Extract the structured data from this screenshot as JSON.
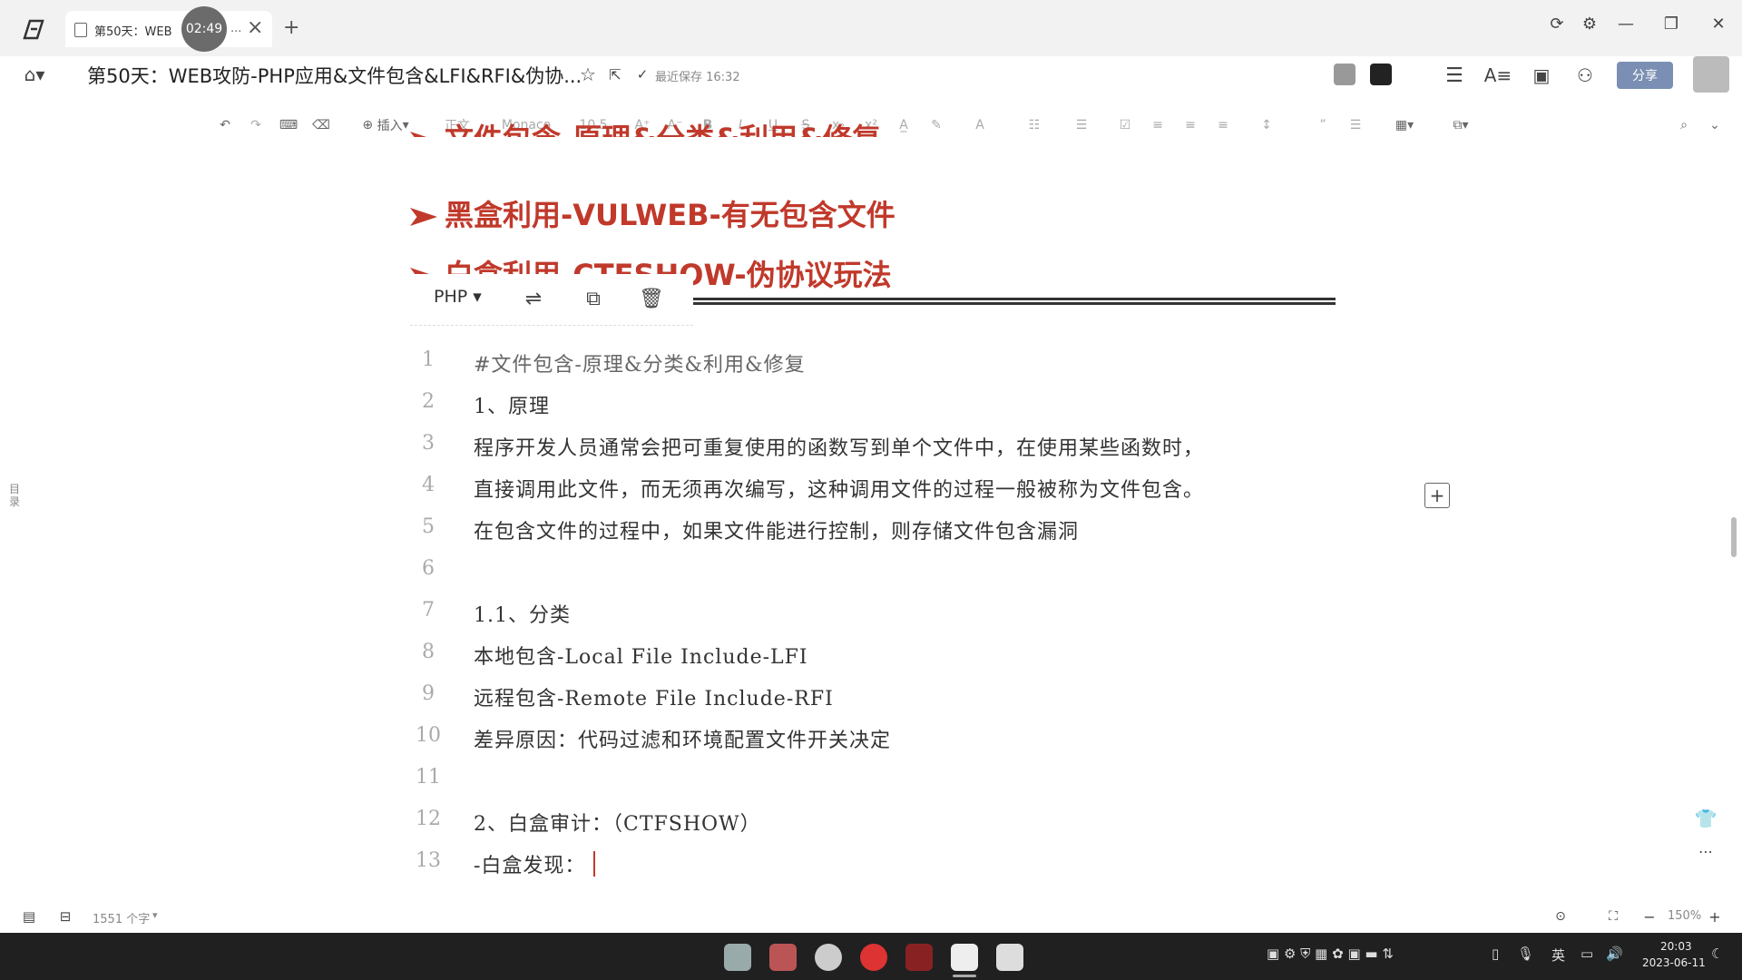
{
  "tab": {
    "title": "第50天：WEB",
    "timer": "02:49",
    "more": "...",
    "close": "×",
    "new": "+"
  },
  "header": {
    "title": "第50天：WEB攻防-PHP应用&文件包含&LFI&RFI&伪协...",
    "saved": "最近保存 16:32",
    "share": "分享"
  },
  "toolbar": {
    "insert": "插入",
    "style": "正文",
    "font": "Monaco",
    "size": "10.5"
  },
  "headings": [
    "文件包含-原理&分类&利用&修复",
    "黑盒利用-VULWEB-有无包含文件",
    "白盒利用-CTFSHOW-伪协议玩法"
  ],
  "code_toolbar": {
    "language": "PHP"
  },
  "code_lines": [
    {
      "n": "1",
      "text": "#文件包含-原理&分类&利用&修复",
      "comment": true
    },
    {
      "n": "2",
      "text": "1、原理",
      "comment": false
    },
    {
      "n": "3",
      "text": "程序开发人员通常会把可重复使用的函数写到单个文件中，在使用某些函数时，",
      "comment": false
    },
    {
      "n": "4",
      "text": "直接调用此文件，而无须再次编写，这种调用文件的过程一般被称为文件包含。",
      "comment": false
    },
    {
      "n": "5",
      "text": "在包含文件的过程中，如果文件能进行控制，则存储文件包含漏洞",
      "comment": false
    },
    {
      "n": "6",
      "text": "",
      "comment": false
    },
    {
      "n": "7",
      "text": "1.1、分类",
      "comment": false
    },
    {
      "n": "8",
      "text": "本地包含-Local File Include-LFI",
      "comment": false
    },
    {
      "n": "9",
      "text": "远程包含-Remote File Include-RFI",
      "comment": false
    },
    {
      "n": "10",
      "text": "差异原因：代码过滤和环境配置文件开关决定",
      "comment": false
    },
    {
      "n": "11",
      "text": "",
      "comment": false
    },
    {
      "n": "12",
      "text": "2、白盒审计：（CTFSHOW）",
      "comment": false
    },
    {
      "n": "13",
      "text": "-白盒发现：",
      "comment": false
    }
  ],
  "sidebar": {
    "toc": "目录"
  },
  "status": {
    "word_count": "1551 个字",
    "zoom": "150%"
  },
  "clock": {
    "time": "20:03",
    "date": "2023-06-11"
  },
  "tray": {
    "lang": "英"
  }
}
